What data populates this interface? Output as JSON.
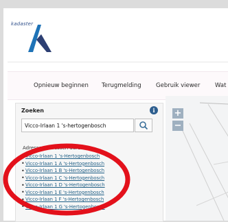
{
  "brand": {
    "name": "kadaster",
    "logo_icon": "kadaster-logo-icon",
    "colors": {
      "blue": "#1f73b7",
      "navy": "#2d3f73"
    }
  },
  "nav": {
    "items": [
      {
        "label": "Opnieuw beginnen"
      },
      {
        "label": "Terugmelding"
      },
      {
        "label": "Gebruik viewer"
      },
      {
        "label": "Wat 's"
      }
    ]
  },
  "search_panel": {
    "title": "Zoeken",
    "info_icon": "info-icon",
    "info_glyph": "i",
    "query": "Vicco-Irlaan 1 's-hertogenbosch",
    "search_icon": "search-icon",
    "results_heading": "Adressen adressen adres",
    "results": [
      "Vicco-Irlaan 1 's-Hertogenbosch",
      "Vicco-Irlaan 1 A 's-Hertogenbosch",
      "Vicco-Irlaan 1 B 's-Hertogenbosch",
      "Vicco-Irlaan 1 C 's-Hertogenbosch",
      "Vicco-Irlaan 1 D 's-Hertogenbosch",
      "Vicco-Irlaan 1 E 's-Hertogenbosch",
      "Vicco-Irlaan 1 F 's-Hertogenbosch",
      "Vicco-Irlaan 1 G 's-Hertogenbosch"
    ]
  },
  "map": {
    "zoom_in": "+",
    "zoom_out": "−"
  },
  "annotation": {
    "color": "#e3111b"
  }
}
